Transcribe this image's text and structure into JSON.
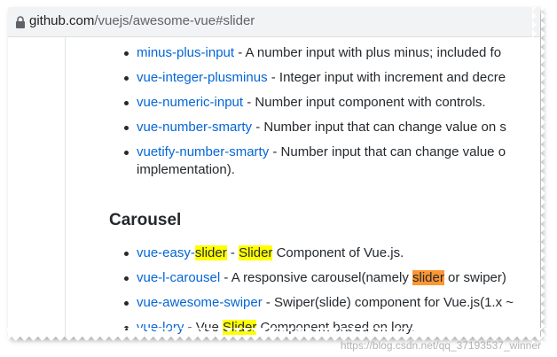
{
  "browser": {
    "url_host": "github.com",
    "url_path": "/vuejs/awesome-vue#slider"
  },
  "number_inputs": [
    {
      "link": "minus-plus-input",
      "desc": " - A number input with plus minus; included fo"
    },
    {
      "link": "vue-integer-plusminus",
      "desc": " - Integer input with increment and decre"
    },
    {
      "link": "vue-numeric-input",
      "desc": " - Number input component with controls."
    },
    {
      "link": "vue-number-smarty",
      "desc": " - Number input that can change value on s"
    },
    {
      "link": "vuetify-number-smarty",
      "desc": " - Number input that can change value o",
      "desc_line2": "implementation)."
    }
  ],
  "section_title": "Carousel",
  "carousel": {
    "item1": {
      "link": "vue-easy-",
      "link_hl": "slider",
      "sep": " - ",
      "hl": "Slider",
      "desc": " Component of Vue.js."
    },
    "item2": {
      "link": "vue-l-carousel",
      "desc_a": " - A responsive carousel(namely ",
      "hl": "slider",
      "desc_b": " or swiper) "
    },
    "item3": {
      "link": "vue-awesome-swiper",
      "desc": " - Swiper(slide) component for Vue.js(1.x ~"
    },
    "item4": {
      "link": "vue-lory",
      "desc_a": " - Vue ",
      "hl": "Slider",
      "desc_b": " Component based on lory."
    }
  },
  "watermark": "https://blog.csdn.net/qq_37193537_winner",
  "colors": {
    "link": "#0366d6",
    "highlight": "#ffff00",
    "active_highlight": "#ff9632"
  }
}
